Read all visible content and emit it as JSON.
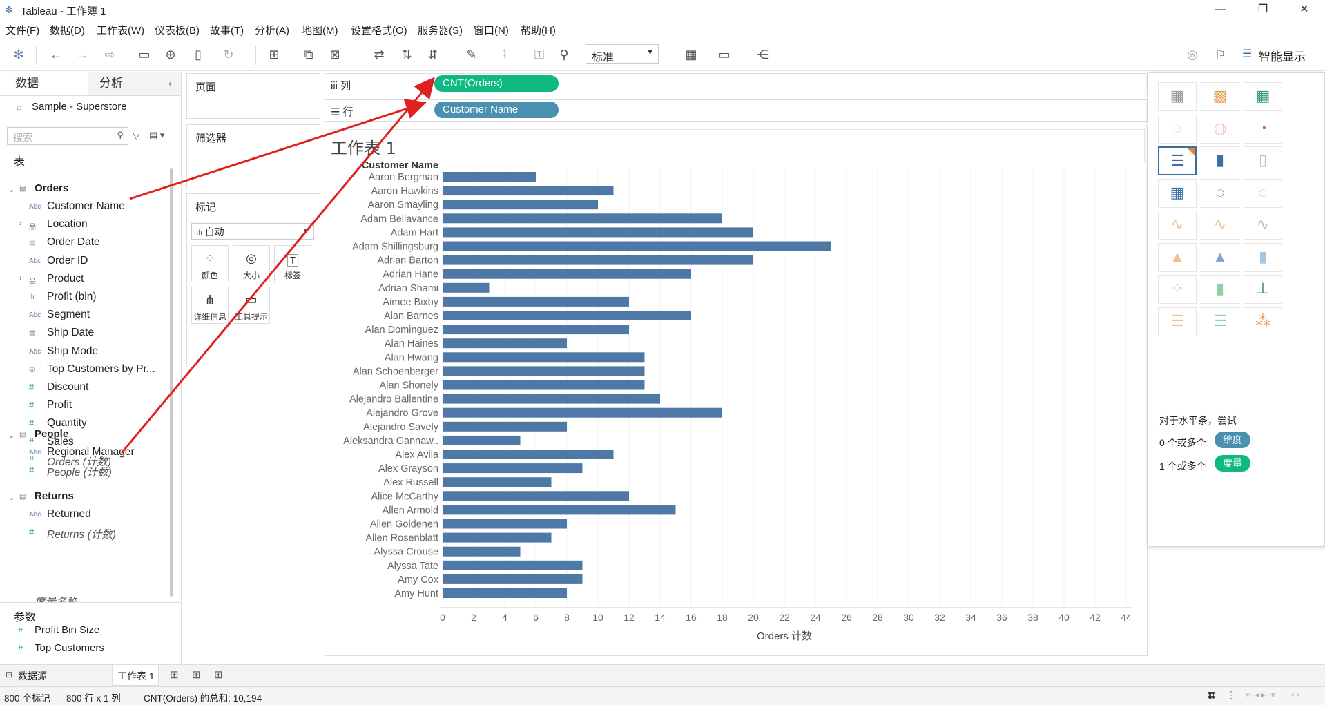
{
  "app": {
    "title": "Tableau - 工作簿 1"
  },
  "menu": [
    "文件(F)",
    "数据(D)",
    "工作表(W)",
    "仪表板(B)",
    "故事(T)",
    "分析(A)",
    "地图(M)",
    "设置格式(O)",
    "服务器(S)",
    "窗口(N)",
    "帮助(H)"
  ],
  "toolbar": {
    "fit_value": "标准",
    "smart_label": "智能显示"
  },
  "datapane": {
    "tab_data": "数据",
    "tab_analysis": "分析",
    "datasource": "Sample - Superstore",
    "search_placeholder": "搜索",
    "tables_heading": "表",
    "params_heading": "参数",
    "groups": [
      {
        "name": "Orders",
        "fields": [
          {
            "label": "Customer Name",
            "icon": "Abc"
          },
          {
            "label": "Location",
            "icon": "hier"
          },
          {
            "label": "Order Date",
            "icon": "date"
          },
          {
            "label": "Order ID",
            "icon": "Abc"
          },
          {
            "label": "Product",
            "icon": "hier"
          },
          {
            "label": "Profit (bin)",
            "icon": "bin"
          },
          {
            "label": "Segment",
            "icon": "Abc"
          },
          {
            "label": "Ship Date",
            "icon": "date"
          },
          {
            "label": "Ship Mode",
            "icon": "Abc"
          },
          {
            "label": "Top Customers by Pr...",
            "icon": "set"
          },
          {
            "label": "Discount",
            "icon": "#"
          },
          {
            "label": "Profit",
            "icon": "#"
          },
          {
            "label": "Quantity",
            "icon": "#"
          },
          {
            "label": "Sales",
            "icon": "#"
          },
          {
            "label": "Orders (计数)",
            "icon": "#"
          }
        ]
      },
      {
        "name": "People",
        "fields": [
          {
            "label": "Regional Manager",
            "icon": "Abc"
          },
          {
            "label": "People (计数)",
            "icon": "#"
          }
        ]
      },
      {
        "name": "Returns",
        "fields": [
          {
            "label": "Returned",
            "icon": "Abc"
          },
          {
            "label": "Returns (计数)",
            "icon": "#"
          }
        ]
      }
    ],
    "cut_off_field": "度量名称",
    "params": [
      "Profit Bin Size",
      "Top Customers"
    ]
  },
  "cards": {
    "pages": "页面",
    "filters": "筛选器",
    "marks": "标记",
    "mark_type": "自动",
    "mark_buttons": [
      "颜色",
      "大小",
      "标签",
      "详细信息",
      "工具提示"
    ]
  },
  "shelves": {
    "columns_label": "列",
    "rows_label": "行",
    "columns_pill": "CNT(Orders)",
    "rows_pill": "Customer Name",
    "measure_color": "#10b981",
    "dimension_color": "#4a90b0"
  },
  "sheet": {
    "title": "工作表 1"
  },
  "chart_data": {
    "type": "bar",
    "orientation": "horizontal",
    "row_header": "Customer Name",
    "xlabel": "Orders 计数",
    "xlim": [
      0,
      44
    ],
    "xticks": [
      0,
      2,
      4,
      6,
      8,
      10,
      12,
      14,
      16,
      18,
      20,
      22,
      24,
      26,
      28,
      30,
      32,
      34,
      36,
      38,
      40,
      42,
      44
    ],
    "bar_color": "#4e79a7",
    "categories": [
      "Aaron Bergman",
      "Aaron Hawkins",
      "Aaron Smayling",
      "Adam Bellavance",
      "Adam Hart",
      "Adam Shillingsburg",
      "Adrian Barton",
      "Adrian Hane",
      "Adrian Shami",
      "Aimee Bixby",
      "Alan Barnes",
      "Alan Dominguez",
      "Alan Haines",
      "Alan Hwang",
      "Alan Schoenberger",
      "Alan Shonely",
      "Alejandro Ballentine",
      "Alejandro Grove",
      "Alejandro Savely",
      "Aleksandra Gannaw..",
      "Alex Avila",
      "Alex Grayson",
      "Alex Russell",
      "Alice McCarthy",
      "Allen Armold",
      "Allen Goldenen",
      "Allen Rosenblatt",
      "Alyssa Crouse",
      "Alyssa Tate",
      "Amy Cox",
      "Amy Hunt"
    ],
    "values": [
      6,
      11,
      10,
      18,
      20,
      25,
      20,
      16,
      3,
      12,
      16,
      12,
      8,
      13,
      13,
      13,
      14,
      18,
      8,
      5,
      11,
      9,
      7,
      12,
      15,
      8,
      7,
      5,
      9,
      9,
      8
    ]
  },
  "smart": {
    "hint": "对于水平条，尝试",
    "line1_prefix": "0 个或多个",
    "line1_pill": "维度",
    "line2_prefix": "1 个或多个",
    "line2_pill": "度量"
  },
  "tabs": {
    "datasource": "数据源",
    "sheet1": "工作表 1"
  },
  "status": {
    "marks": "800 个标记",
    "rows_cols": "800 行 x 1 列",
    "sum": "CNT(Orders) 的总和: 10,194"
  },
  "annotation_color": "#e02020"
}
